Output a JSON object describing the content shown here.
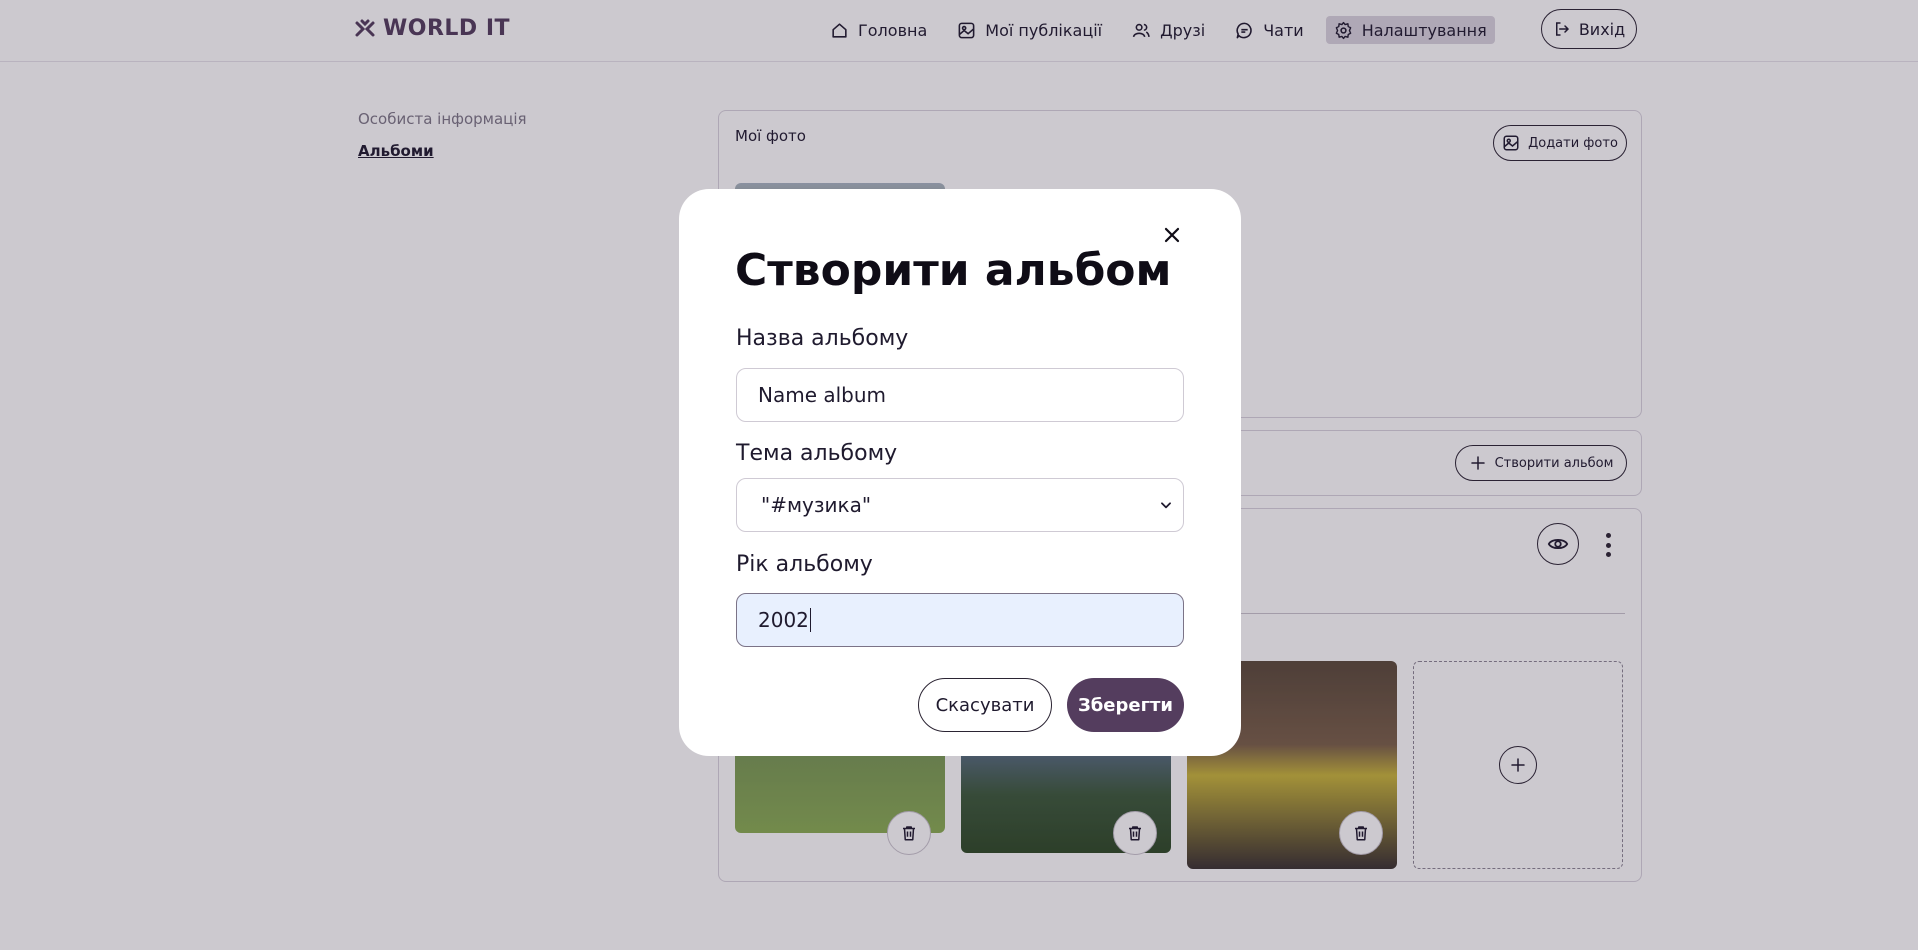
{
  "header": {
    "logo": "WORLD IT",
    "nav": [
      {
        "label": "Головна",
        "icon": "home-icon"
      },
      {
        "label": "Мої публікації",
        "icon": "image-icon"
      },
      {
        "label": "Друзі",
        "icon": "users-icon"
      },
      {
        "label": "Чати",
        "icon": "chat-icon"
      },
      {
        "label": "Налаштування",
        "icon": "gear-icon",
        "active": true
      }
    ],
    "logout": "Вихід"
  },
  "sidebar": {
    "items": [
      {
        "label": "Особиста інформація"
      },
      {
        "label": "Альбоми",
        "active": true
      }
    ]
  },
  "photos": {
    "title": "Мої фото",
    "add_button": "Додати фото"
  },
  "albums": {
    "create_button": "Створити альбом"
  },
  "modal": {
    "title": "Створити альбом",
    "name_label": "Назва альбому",
    "name_value": "Name album",
    "theme_label": "Тема альбому",
    "theme_value": "\"#музика\"",
    "year_label": "Рік альбому",
    "year_value": "2002",
    "cancel": "Скасувати",
    "save": "Зберегти"
  },
  "colors": {
    "accent": "#543d5e",
    "overlay": "rgba(40,30,55,0.24)",
    "autofill": "#e8f0fe"
  }
}
